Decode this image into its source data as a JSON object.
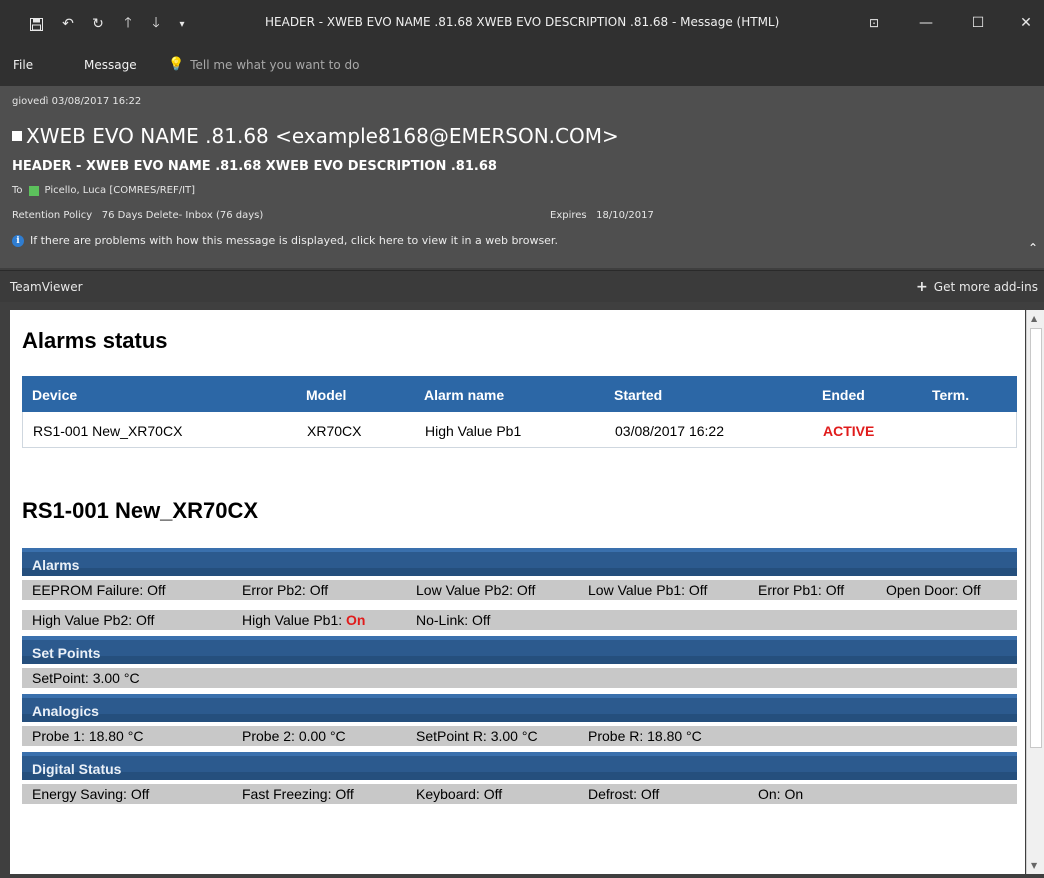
{
  "window": {
    "title": "HEADER - XWEB EVO NAME .81.68 XWEB EVO DESCRIPTION .81.68  -  Message (HTML)"
  },
  "menu": {
    "file": "File",
    "message": "Message",
    "tell_me": "Tell me what you want to do"
  },
  "header": {
    "date": "giovedì 03/08/2017 16:22",
    "from": "XWEB EVO NAME .81.68 <example8168@EMERSON.COM>",
    "subject": "HEADER - XWEB EVO NAME .81.68 XWEB EVO DESCRIPTION .81.68",
    "to_label": "To",
    "to_name": "Picello, Luca [COMRES/REF/IT]",
    "retention_label": "Retention Policy",
    "retention_value": "76 Days Delete- Inbox (76 days)",
    "expires_label": "Expires",
    "expires_value": "18/10/2017",
    "info": "If there are problems with how this message is displayed, click here to view it in a web browser."
  },
  "addins": {
    "name": "TeamViewer",
    "more": "Get more add-ins"
  },
  "alarms_status": {
    "heading": "Alarms status",
    "columns": [
      "Device",
      "Model",
      "Alarm name",
      "Started",
      "Ended",
      "Term."
    ],
    "rows": [
      [
        "RS1-001 New_XR70CX",
        "XR70CX",
        "High Value Pb1",
        "03/08/2017 16:22",
        "ACTIVE",
        ""
      ]
    ]
  },
  "device": {
    "heading": "RS1-001 New_XR70CX",
    "sections": {
      "alarms": {
        "title": "Alarms",
        "row1": [
          "EEPROM Failure: Off",
          "Error Pb2: Off",
          "Low Value Pb2: Off",
          "Low Value Pb1: Off",
          "Error Pb1: Off",
          "Open Door: Off"
        ],
        "row2_a": "High Value Pb2: Off",
        "row2_b_label": "High Value Pb1: ",
        "row2_b_value": "On",
        "row2_c": "No-Link: Off"
      },
      "setpoints": {
        "title": "Set Points",
        "row1": [
          "SetPoint: 3.00 °C"
        ]
      },
      "analogics": {
        "title": "Analogics",
        "row1": [
          "Probe 1: 18.80 °C",
          "Probe 2: 0.00 °C",
          "SetPoint R: 3.00 °C",
          "Probe R: 18.80 °C"
        ]
      },
      "digital": {
        "title": "Digital Status",
        "row1": [
          "Energy Saving: Off",
          "Fast Freezing: Off",
          "Keyboard: Off",
          "Defrost: Off",
          "On: On"
        ]
      }
    }
  }
}
